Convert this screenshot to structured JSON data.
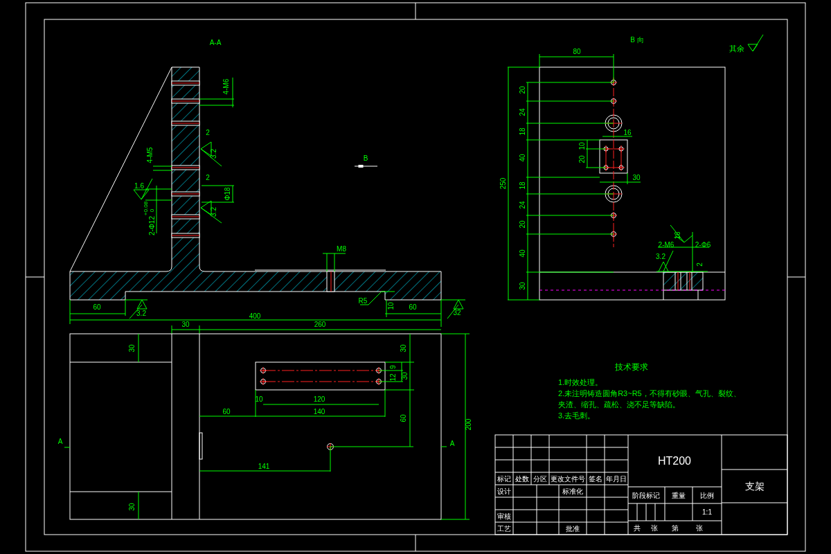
{
  "section_view": {
    "title": "A-A",
    "labels": [
      "4-M6",
      "2",
      "3.2",
      "4-M5",
      "2",
      "1.6",
      "Φ18",
      "3.2",
      "2-Φ12",
      "+0.08",
      "0",
      "B",
      "M8",
      "60",
      "3.2",
      "R5",
      "10",
      "60",
      "32",
      "400",
      "30",
      "260"
    ]
  },
  "plan_view": {
    "labels": [
      "30",
      "30",
      "30",
      "9",
      "12",
      "30",
      "10",
      "120",
      "60",
      "140",
      "60",
      "200",
      "141"
    ],
    "section_marks": [
      "A",
      "A"
    ]
  },
  "view_b": {
    "title": "B 向",
    "labels": [
      "80",
      "250",
      "20",
      "24",
      "18",
      "40",
      "18",
      "24",
      "20",
      "40",
      "30",
      "16",
      "10",
      "20",
      "30",
      "16",
      "2-M6",
      "2-Φ6",
      "3.2",
      "2"
    ]
  },
  "roughness_note": {
    "text": "其余"
  },
  "technical_requirements": {
    "title": "技术要求",
    "items": [
      "1.时效处理。",
      "2.未注明铸造圆角R3~R5，不得有砂眼、气孔、裂纹、",
      "夹渣、缩孔、疏松、浇不足等缺陷。",
      "3.去毛刺。"
    ]
  },
  "title_block": {
    "material": "HT200",
    "part_name": "支架",
    "cells": [
      "标记",
      "处数",
      "分区",
      "更改文件号",
      "签名",
      "年月日",
      "设计",
      "标准化",
      "审核",
      "工艺",
      "批准",
      "阶段标记",
      "重量",
      "比例",
      "1:1",
      "共",
      "张",
      "第",
      "张"
    ]
  }
}
